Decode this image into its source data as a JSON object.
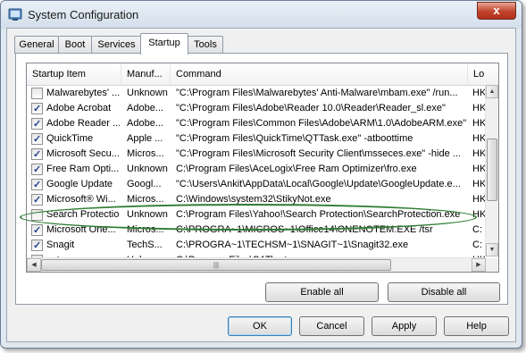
{
  "window": {
    "title": "System Configuration",
    "close_glyph": "x"
  },
  "tabs": [
    {
      "label": "General"
    },
    {
      "label": "Boot"
    },
    {
      "label": "Services"
    },
    {
      "label": "Startup"
    },
    {
      "label": "Tools"
    }
  ],
  "active_tab": "Startup",
  "list": {
    "columns": [
      "Startup Item",
      "Manuf...",
      "Command",
      "Lo"
    ],
    "rows": [
      {
        "checked": false,
        "item": "Malwarebytes' ...",
        "manuf": "Unknown",
        "command": "\"C:\\Program Files\\Malwarebytes' Anti-Malware\\mbam.exe\" /run...",
        "loc": "HK"
      },
      {
        "checked": true,
        "item": "Adobe Acrobat",
        "manuf": "Adobe...",
        "command": "\"C:\\Program Files\\Adobe\\Reader 10.0\\Reader\\Reader_sl.exe\"",
        "loc": "HK"
      },
      {
        "checked": true,
        "item": "Adobe Reader ...",
        "manuf": "Adobe...",
        "command": "\"C:\\Program Files\\Common Files\\Adobe\\ARM\\1.0\\AdobeARM.exe\"",
        "loc": "HK"
      },
      {
        "checked": true,
        "item": "QuickTime",
        "manuf": "Apple ...",
        "command": "\"C:\\Program Files\\QuickTime\\QTTask.exe\" -atboottime",
        "loc": "HK"
      },
      {
        "checked": true,
        "item": "Microsoft Secu...",
        "manuf": "Micros...",
        "command": "\"C:\\Program Files\\Microsoft Security Client\\msseces.exe\" -hide ...",
        "loc": "HK"
      },
      {
        "checked": true,
        "item": "Free Ram Opti...",
        "manuf": "Unknown",
        "command": "C:\\Program Files\\AceLogix\\Free Ram Optimizer\\fro.exe",
        "loc": "HK"
      },
      {
        "checked": true,
        "item": "Google Update",
        "manuf": "Googl...",
        "command": "\"C:\\Users\\Ankit\\AppData\\Local\\Google\\Update\\GoogleUpdate.e...",
        "loc": "HK"
      },
      {
        "checked": true,
        "item": "Microsoft® Wi...",
        "manuf": "Micros...",
        "command": "C:\\Windows\\system32\\StikyNot.exe",
        "loc": "HK"
      },
      {
        "checked": false,
        "item": "Search Protection",
        "manuf": "Unknown",
        "command": "C:\\Program Files\\Yahoo!\\Search Protection\\SearchProtection.exe",
        "loc": "HK"
      },
      {
        "checked": true,
        "item": "Microsoft One...",
        "manuf": "Micros...",
        "command": "C:\\PROGRA~1\\MICROS~1\\Office14\\ONENOTEM.EXE /tsr",
        "loc": "C:"
      },
      {
        "checked": true,
        "item": "Snagit",
        "manuf": "TechS...",
        "command": "C:\\PROGRA~1\\TECHSM~1\\SNAGIT~1\\Snagit32.exe",
        "loc": "C:"
      },
      {
        "checked": true,
        "item": "cat",
        "manuf": "Unknown",
        "command": "C:\\Program Files\\CAT\\cat.exe",
        "loc": "HK"
      }
    ],
    "tick_glyph": "✓",
    "scroll_up": "▲",
    "scroll_down": "▼",
    "scroll_left": "◀",
    "scroll_right": "▶",
    "grip": "|||"
  },
  "buttons": {
    "enable_all": "Enable all",
    "disable_all": "Disable all",
    "ok": "OK",
    "cancel": "Cancel",
    "apply": "Apply",
    "help": "Help"
  },
  "colors": {
    "highlight_oval": "#2e7d32",
    "check_tick": "#25408f"
  }
}
